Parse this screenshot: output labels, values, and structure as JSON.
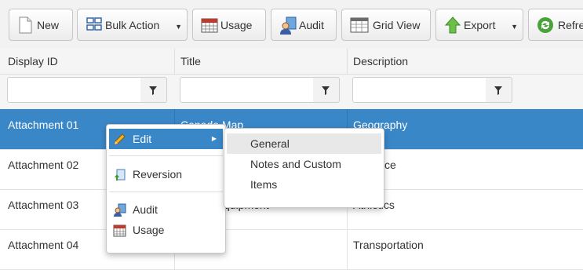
{
  "toolbar": {
    "buttons": [
      {
        "label": "New",
        "icon": "new-document-icon"
      },
      {
        "label": "Bulk Action",
        "icon": "grid-icon",
        "dropdown": true
      },
      {
        "label": "Usage",
        "icon": "calendar-icon"
      },
      {
        "label": "Audit",
        "icon": "audit-user-icon"
      },
      {
        "label": "Grid View",
        "icon": "grid-view-icon"
      },
      {
        "label": "Export",
        "icon": "export-arrow-icon",
        "dropdown": true
      },
      {
        "label": "Refre",
        "icon": "refresh-icon"
      }
    ]
  },
  "grid": {
    "columns": [
      "Display ID",
      "Title",
      "Description"
    ],
    "filters": [
      "",
      "",
      ""
    ],
    "rows": [
      {
        "id": "Attachment 01",
        "title": "Canada Map",
        "description": "Geography",
        "selected": true
      },
      {
        "id": "Attachment 02",
        "title": "",
        "description": "ce"
      },
      {
        "id": "Attachment 03",
        "title": "quipment",
        "description": "Athletics"
      },
      {
        "id": "Attachment 04",
        "title": "",
        "description": "Transportation"
      }
    ]
  },
  "context_menu": {
    "items": [
      {
        "label": "Edit",
        "icon": "pencil-icon",
        "submenu": true,
        "active": true
      },
      {
        "label": "Reversion",
        "icon": "reversion-icon"
      },
      {
        "label": "Audit",
        "icon": "audit-user-icon"
      },
      {
        "label": "Usage",
        "icon": "calendar-icon"
      }
    ]
  },
  "edit_submenu": {
    "items": [
      "General",
      "Notes and Custom",
      "Items"
    ]
  },
  "colors": {
    "selection": "#3a87c8",
    "toolbar_bg": "#f2f2f2",
    "header_bg": "#f5f5f5"
  }
}
